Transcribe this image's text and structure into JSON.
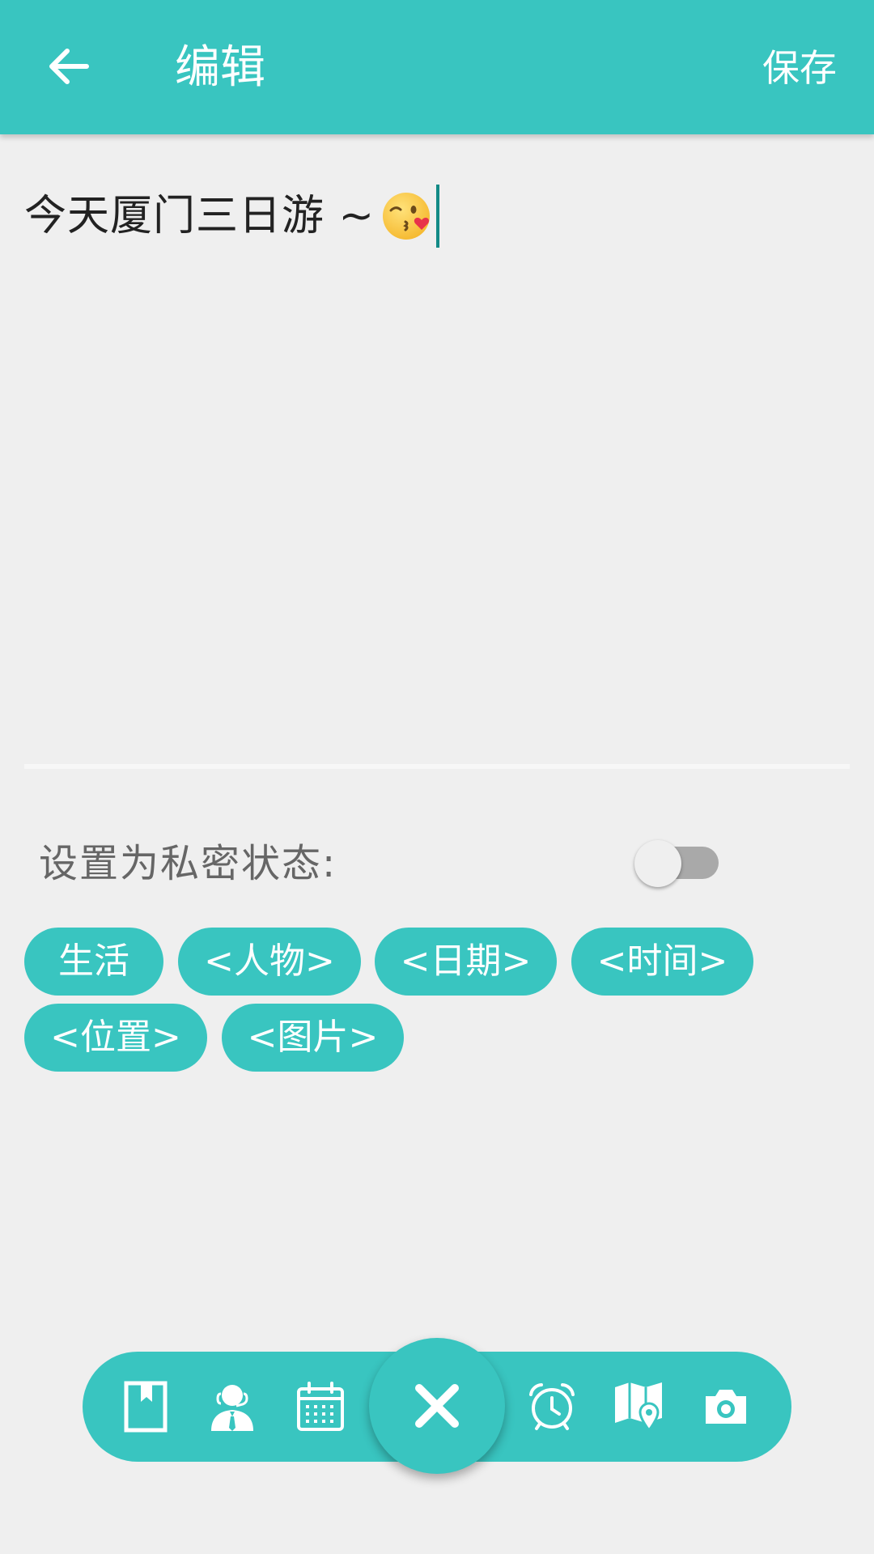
{
  "colors": {
    "accent": "#39c5c0",
    "background": "#efefef",
    "caret": "#128a86"
  },
  "header": {
    "title": "编辑",
    "save_label": "保存",
    "back_icon": "arrow-left-icon"
  },
  "editor": {
    "text": "今天厦门三日游 ~",
    "emoji": "kissing-face-with-heart-emoji"
  },
  "privacy": {
    "label": "设置为私密状态:",
    "enabled": false
  },
  "tags": [
    "生活",
    "<人物>",
    "<日期>",
    "<时间>",
    "<位置>",
    "<图片>"
  ],
  "toolbar": {
    "icons": [
      "bookmark-icon",
      "person-icon",
      "calendar-icon",
      "close-icon",
      "alarm-clock-icon",
      "map-pin-icon",
      "camera-icon"
    ]
  }
}
